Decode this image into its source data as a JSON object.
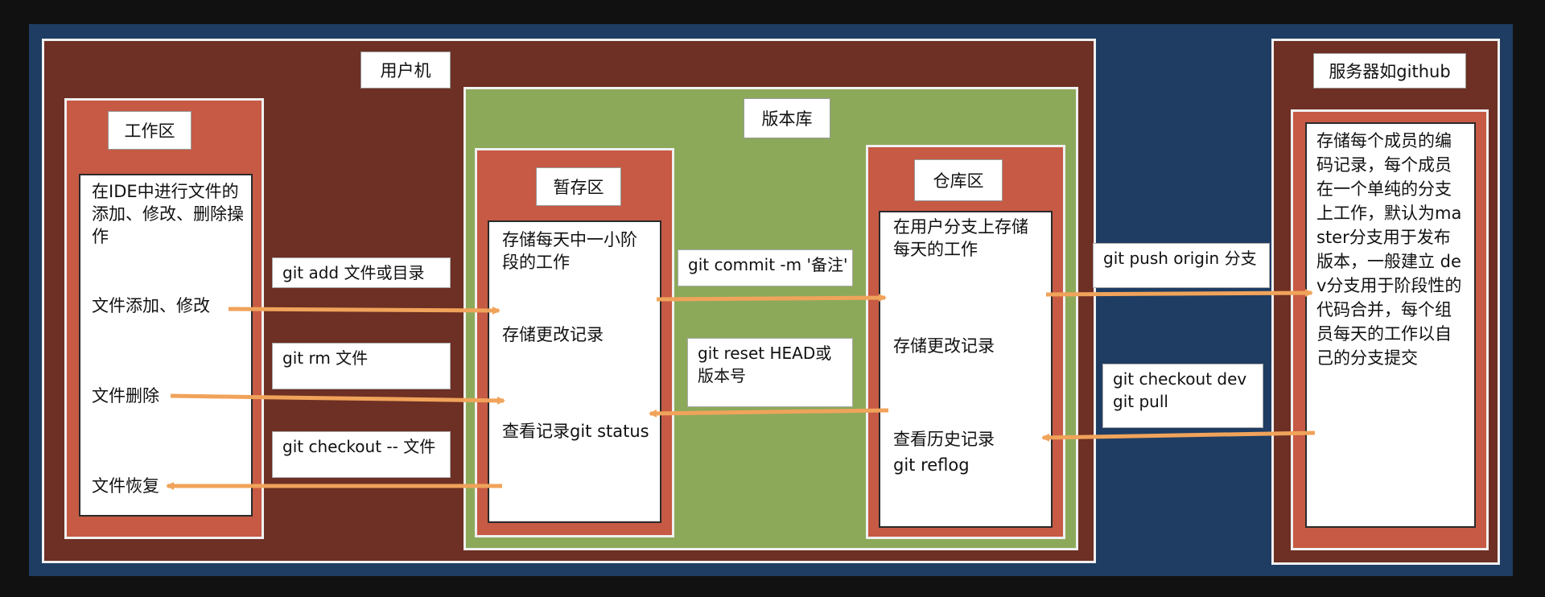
{
  "user_machine": {
    "title": "用户机"
  },
  "workspace": {
    "title": "工作区",
    "desc": "在IDE中进行文件的添加、修改、删除操作",
    "items": [
      "文件添加、修改",
      "文件删除",
      "文件恢复"
    ]
  },
  "repo": {
    "title": "版本库"
  },
  "staging": {
    "title": "暂存区",
    "items": [
      "存储每天中一小阶段的工作",
      "存储更改记录",
      "查看记录git status"
    ]
  },
  "warehouse": {
    "title": "仓库区",
    "items": [
      "在用户分支上存储每天的工作",
      "存储更改记录",
      "查看历史记录",
      "git reflog"
    ]
  },
  "server": {
    "title": "服务器如github",
    "desc": "存储每个成员的编码记录，每个成员在一个单纯的分支上工作，默认为master分支用于发布版本，一般建立 dev分支用于阶段性的代码合并，每个组员每天的工作以自己的分支提交"
  },
  "commands": {
    "add": "git add 文件或目录",
    "rm": "git rm 文件",
    "checkout": "git checkout -- 文件",
    "commit": "git commit -m '备注'",
    "reset_1": "git reset HEAD或",
    "reset_2": "版本号",
    "push": "git push origin 分支",
    "pull_1": "git checkout dev",
    "pull_2": "git pull"
  },
  "colors": {
    "background": "#111111",
    "navy": "#1f3d63",
    "brown": "#6e2f24",
    "green": "#8ca95a",
    "salmon": "#c65a44",
    "arrow": "#f0a35a"
  }
}
